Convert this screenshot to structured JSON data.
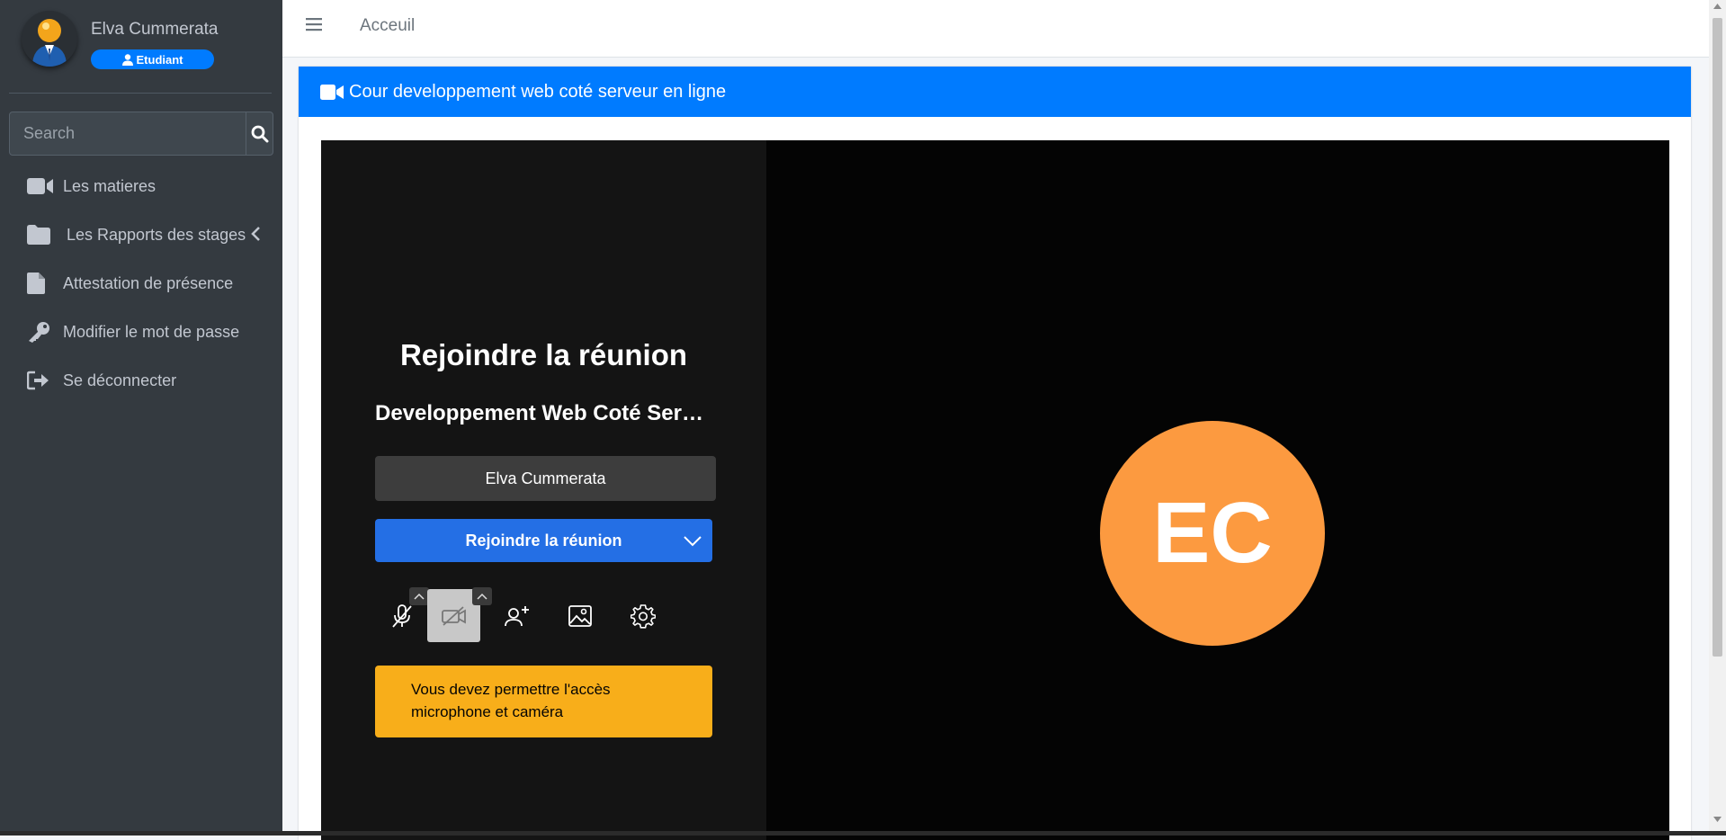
{
  "user": {
    "name": "Elva Cummerata",
    "role": "Etudiant"
  },
  "search": {
    "placeholder": "Search"
  },
  "nav": [
    {
      "label": "Les matieres",
      "icon": "video-icon"
    },
    {
      "label": "Les Rapports des stages",
      "icon": "folder-icon"
    },
    {
      "label": "Attestation de présence",
      "icon": "file-icon"
    },
    {
      "label": "Modifier le mot de passe",
      "icon": "key-icon"
    },
    {
      "label": "Se déconnecter",
      "icon": "sign-out-icon"
    }
  ],
  "topbar": {
    "breadcrumb": "Acceuil"
  },
  "card": {
    "title": "Cour developpement web coté serveur en ligne"
  },
  "meeting": {
    "title": "Rejoindre la réunion",
    "subject": "Developpement Web Coté Serveur",
    "display_name": "Elva Cummerata",
    "join_label": "Rejoindre la réunion",
    "warning": "Vous devez permettre l'accès microphone et caméra",
    "initials": "EC",
    "avatar_color": "#fc9a40",
    "join_color": "#246fe5",
    "warning_color": "#f8ae1a"
  },
  "colors": {
    "sidebar": "#343a40",
    "accent": "#007bff"
  }
}
